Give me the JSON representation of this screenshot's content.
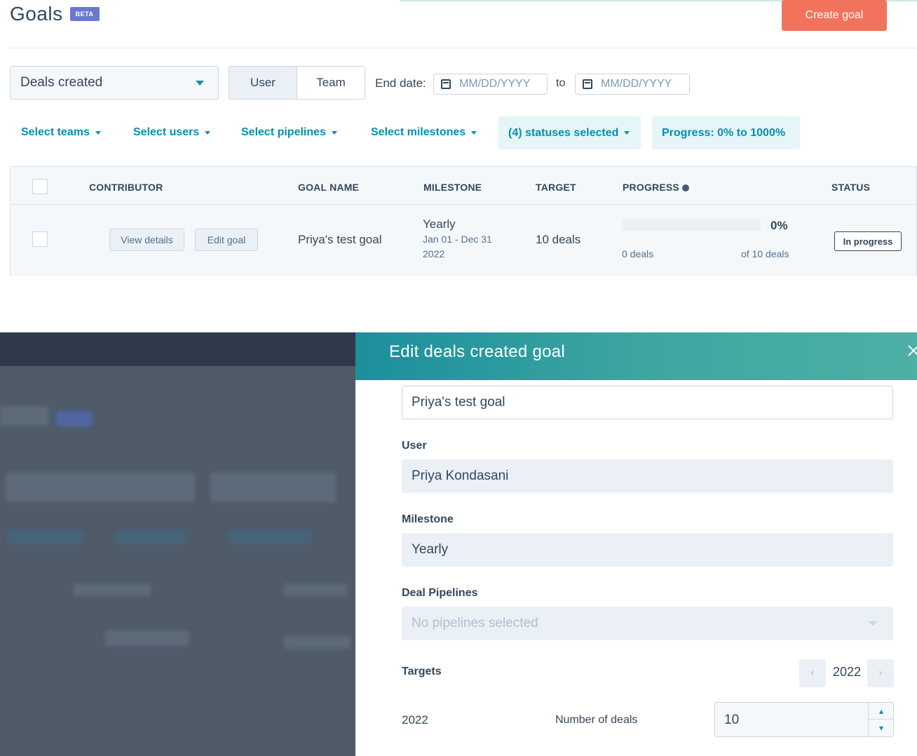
{
  "header": {
    "title": "Goals",
    "beta": "BETA",
    "create_button": "Create goal"
  },
  "toolbar": {
    "goal_type": "Deals created",
    "segment": {
      "user": "User",
      "team": "Team",
      "selected": "User"
    },
    "end_date_label": "End date:",
    "date_from_placeholder": "MM/DD/YYYY",
    "to_label": "to",
    "date_to_placeholder": "MM/DD/YYYY"
  },
  "filters": {
    "teams": "Select teams",
    "users": "Select users",
    "pipelines": "Select pipelines",
    "milestones": "Select milestones",
    "statuses": "(4) statuses selected",
    "progress": "Progress: 0% to 1000%"
  },
  "table": {
    "columns": [
      "CONTRIBUTOR",
      "GOAL NAME",
      "MILESTONE",
      "TARGET",
      "PROGRESS",
      "STATUS"
    ],
    "rows": [
      {
        "view_details": "View details",
        "edit_goal": "Edit goal",
        "goal_name": "Priya's test goal",
        "milestone": "Yearly",
        "milestone_range": "Jan 01 - Dec 31",
        "milestone_year": "2022",
        "target": "10 deals",
        "progress_pct": "0%",
        "progress_fraction": 0,
        "progress_current": "0 deals",
        "progress_total": "of 10 deals",
        "status": "In progress"
      }
    ]
  },
  "panel": {
    "title": "Edit deals created goal",
    "goal_name_value": "Priya's test goal",
    "user_label": "User",
    "user_value": "Priya Kondasani",
    "milestone_label": "Milestone",
    "milestone_value": "Yearly",
    "pipelines_label": "Deal Pipelines",
    "pipelines_placeholder": "No pipelines selected",
    "targets_label": "Targets",
    "targets_year": "2022",
    "row_year": "2022",
    "number_label": "Number of deals",
    "number_value": "10"
  },
  "colors": {
    "accent": "#0091ae",
    "create_button": "#f2735b",
    "beta_badge": "#6a78d1",
    "panel_header": "#3fa7a0",
    "overlay": "#4f5b69"
  },
  "icons": [
    "calendar-icon",
    "caret-down-icon",
    "info-icon",
    "close-icon",
    "chevron-left-icon",
    "chevron-right-icon",
    "chevron-up-icon",
    "chevron-down-icon"
  ]
}
